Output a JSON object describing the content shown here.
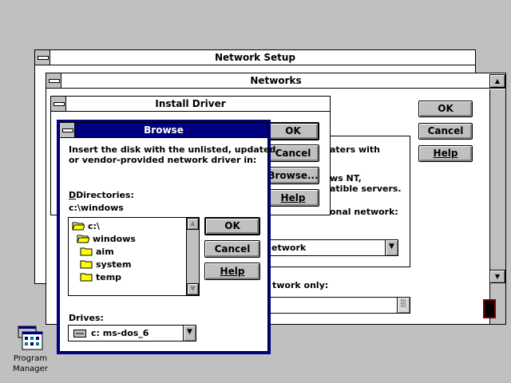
{
  "network_setup": {
    "title": "Network Setup"
  },
  "networks": {
    "title": "Networks",
    "ok_label": "OK",
    "cancel_label": "Cancel",
    "help_label": "Help",
    "frag_1": "aters with",
    "frag_2": "ws NT,",
    "frag_3": "atible servers.",
    "frag_4": "onal network:",
    "combo_value": "etwork",
    "frag_5": "twork only:"
  },
  "install_driver": {
    "title": "Install Driver",
    "ok_label": "OK",
    "cancel_label": "Cancel",
    "browse_label": "Browse...",
    "help_label": "Help"
  },
  "browse": {
    "title": "Browse",
    "instructions_line1": "Insert the disk with the unlisted, updated,",
    "instructions_line2": "or vendor-provided network driver in:",
    "directories_label": "Directories:",
    "current_path": "c:\\windows",
    "tree": [
      {
        "label": "c:\\",
        "open": true
      },
      {
        "label": "windows",
        "open": true
      },
      {
        "label": "aim",
        "open": false
      },
      {
        "label": "system",
        "open": false
      },
      {
        "label": "temp",
        "open": false
      }
    ],
    "drives_label": "Drives:",
    "drive_value": "c: ms-dos_6",
    "ok_label": "OK",
    "cancel_label": "Cancel",
    "help_label": "Help"
  },
  "desktop": {
    "program_manager_line1": "Program",
    "program_manager_line2": "Manager"
  }
}
